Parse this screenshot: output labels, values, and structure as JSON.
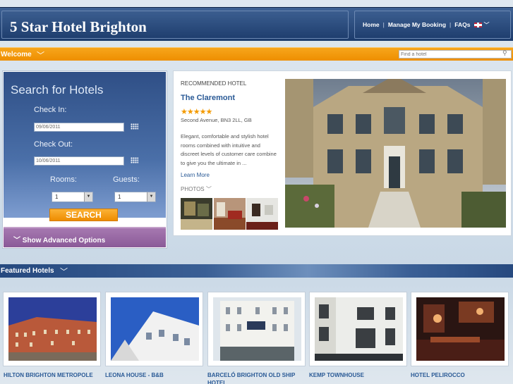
{
  "header": {
    "site_title": "5 Star Hotel Brighton",
    "nav": [
      "Home",
      "Manage My Booking",
      "FAQs"
    ],
    "language_flag": "uk-flag-icon"
  },
  "welcome_bar": {
    "label": "Welcome",
    "find_placeholder": "Find a hotel"
  },
  "search": {
    "title": "Search for Hotels",
    "check_in_label": "Check In:",
    "check_in_value": "09/06/2011",
    "check_out_label": "Check Out:",
    "check_out_value": "10/06/2011",
    "rooms_label": "Rooms:",
    "rooms_value": "1",
    "guests_label": "Guests:",
    "guests_value": "1",
    "search_button": "SEARCH",
    "advanced_label": "Show Advanced Options"
  },
  "recommended": {
    "label": "RECOMMENDED HOTEL",
    "hotel_name": "The Claremont",
    "stars": "★★★★★",
    "address": "Second Avenue, BN3 2LL, GB",
    "description": "Elegant, comfortable and stylish hotel rooms combined with intuitive and discreet levels of customer care combine to give you the ultimate in ...",
    "learn_more": "Learn More",
    "photos_label": "PHOTOS"
  },
  "featured": {
    "label": "Featured Hotels",
    "hotels": [
      {
        "name": "HILTON BRIGHTON METROPOLE"
      },
      {
        "name": "LEONA HOUSE - B&B"
      },
      {
        "name": "BARCELÓ BRIGHTON OLD SHIP HOTEL"
      },
      {
        "name": "KEMP TOWNHOUSE"
      },
      {
        "name": "HOTEL PELIROCCO"
      }
    ]
  },
  "colors": {
    "header_blue": "#1c3b6b",
    "orange": "#ee8f00",
    "purple": "#8a5a98",
    "link_blue": "#2a5a96"
  }
}
